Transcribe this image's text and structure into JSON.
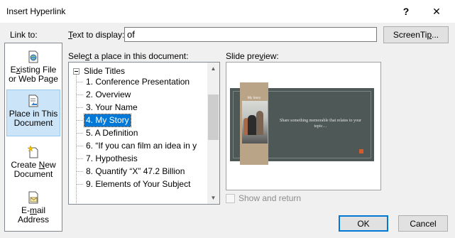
{
  "window": {
    "title": "Insert Hyperlink",
    "help_glyph": "?",
    "close_glyph": "✕"
  },
  "link_to": {
    "label": "Link to:",
    "items": [
      {
        "line1": "Existing File",
        "line2": "or Web Page",
        "icon": "web-page-icon",
        "selected": false
      },
      {
        "line1": "Place in This",
        "line2": "Document",
        "icon": "document-place-icon",
        "selected": true
      },
      {
        "line1": "Create New",
        "line2": "Document",
        "icon": "new-document-icon",
        "selected": false
      },
      {
        "line1": "E-mail",
        "line2": "Address",
        "icon": "email-icon",
        "selected": false
      }
    ]
  },
  "text_to_display": {
    "label": "Text to display:",
    "value": "of"
  },
  "screentip_button": "ScreenTip...",
  "place": {
    "label": "Select a place in this document:",
    "root": "Slide Titles",
    "items": [
      "1. Conference Presentation",
      "2. Overview",
      "3. Your Name",
      "4. My Story",
      "5. A Definition",
      "6. “If you can film an idea in y",
      "7. Hypothesis",
      "8. Quantify “X” 47.2 Billion",
      "9. Elements of  Your Subject"
    ],
    "selected_index": 3
  },
  "preview": {
    "label": "Slide preview:",
    "slide_title": "My Story",
    "slide_body": "Share something memorable that relates to your topic…",
    "colors": {
      "background": "#4e5856",
      "band": "#b9a488",
      "accent": "#d55a2c"
    }
  },
  "show_and_return": {
    "label": "Show and return",
    "checked": false,
    "enabled": false
  },
  "buttons": {
    "ok": "OK",
    "cancel": "Cancel"
  }
}
